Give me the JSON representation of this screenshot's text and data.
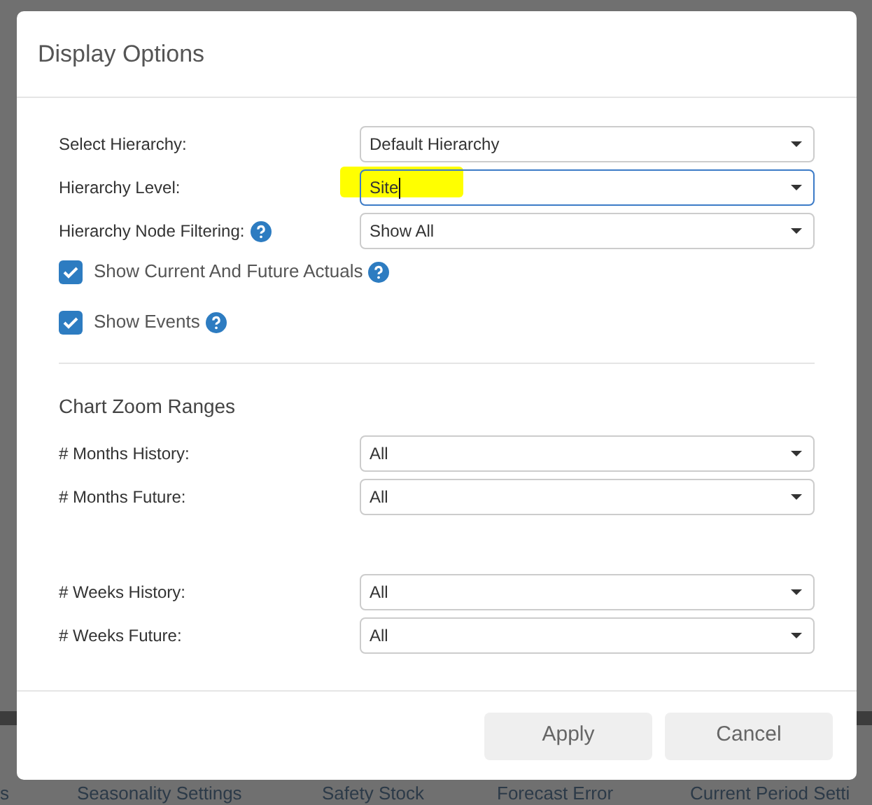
{
  "background_tabs": [
    "s",
    "Seasonality Settings",
    "Safety Stock",
    "Forecast Error",
    "Current Period Setti"
  ],
  "dialog": {
    "title": "Display Options",
    "fields": [
      {
        "label": "Select Hierarchy:",
        "value": "Default Hierarchy",
        "help": false,
        "focused": false,
        "highlighted": false
      },
      {
        "label": "Hierarchy Level:",
        "value": "Site",
        "help": false,
        "focused": true,
        "highlighted": true
      },
      {
        "label": "Hierarchy Node Filtering:",
        "value": "Show All",
        "help": true,
        "focused": false,
        "highlighted": false
      }
    ],
    "checkboxes": [
      {
        "label": "Show Current And Future Actuals",
        "checked": true,
        "help": true
      },
      {
        "label": "Show Events",
        "checked": true,
        "help": true
      }
    ],
    "section_title": "Chart Zoom Ranges",
    "zoom_groups": [
      [
        {
          "label": "# Months History:",
          "value": "All"
        },
        {
          "label": "# Months Future:",
          "value": "All"
        }
      ],
      [
        {
          "label": "# Weeks History:",
          "value": "All"
        },
        {
          "label": "# Weeks Future:",
          "value": "All"
        }
      ]
    ],
    "buttons": [
      {
        "label": "Apply"
      },
      {
        "label": "Cancel"
      }
    ]
  }
}
